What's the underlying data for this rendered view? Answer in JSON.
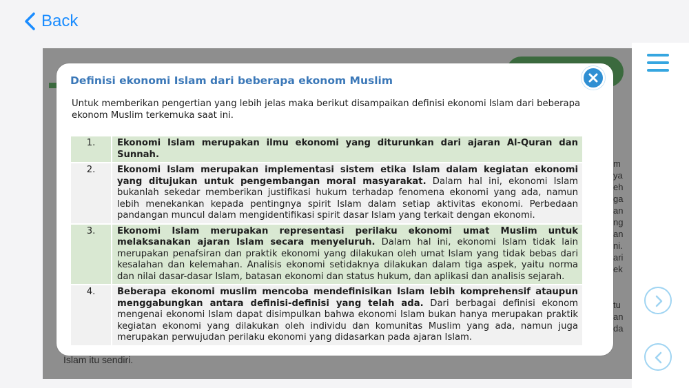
{
  "nav": {
    "back_label": "Back"
  },
  "background": {
    "fragments_top": [
      "m",
      "ya",
      "eh",
      "ga",
      "an",
      "ng",
      "an",
      "ni.",
      "ari",
      "ek"
    ],
    "fragments_bottom": [
      "tu",
      "an",
      "da"
    ],
    "bottom_text": "Islam itu sendiri."
  },
  "modal": {
    "title": "Definisi ekonomi Islam dari beberapa ekonom Muslim",
    "intro": "Untuk memberikan pengertian yang lebih jelas maka berikut disampaikan definisi ekonomi Islam dari beberapa ekonom Muslim terkemuka saat ini.",
    "items": [
      {
        "num": "1.",
        "bold": "Ekonomi Islam merupakan ilmu ekonomi yang diturunkan dari ajaran Al-Quran dan Sunnah.",
        "rest": ""
      },
      {
        "num": "2.",
        "bold": "Ekonomi Islam merupakan implementasi sistem etika Islam dalam kegiatan ekonomi yang ditujukan untuk pengembangan moral masyarakat.",
        "rest": " Dalam hal ini, ekonomi Islam bukanlah sekedar memberikan justifikasi hukum terhadap fenomena ekonomi yang ada, namun lebih menekankan kepada pentingnya spirit Islam dalam setiap aktivitas ekonomi. Perbedaan pandangan muncul dalam mengidentifikasi spirit dasar Islam yang terkait dengan ekonomi."
      },
      {
        "num": "3.",
        "bold": "Ekonomi Islam merupakan representasi perilaku ekonomi umat Muslim untuk melaksanakan ajaran Islam secara menyeluruh.",
        "rest": " Dalam hal ini, ekonomi Islam tidak lain merupakan penafsiran dan praktik ekonomi yang dilakukan oleh umat Islam yang tidak bebas dari kesalahan dan kelemahan. Analisis ekonomi setidaknya dilakukan dalam tiga aspek, yaitu norma dan nilai dasar-dasar Islam, batasan ekonomi dan status hukum, dan aplikasi dan analisis sejarah."
      },
      {
        "num": "4.",
        "bold": "Beberapa ekonomi muslim mencoba mendefinisikan Islam lebih komprehensif ataupun menggabungkan antara definisi-definisi yang telah ada.",
        "rest": " Dari berbagai definisi ekonom mengenai ekonomi Islam dapat disimpulkan bahwa ekonomi Islam bukan hanya merupakan praktik kegiatan ekonomi yang dilakukan oleh individu dan komunitas Muslim yang ada, namun juga merupakan perwujudan perilaku ekonomi yang didasarkan pada ajaran Islam."
      }
    ]
  },
  "icons": {
    "back": "chevron-left-icon",
    "menu": "hamburger-menu-icon",
    "next": "chevron-right-circle-icon",
    "prev": "chevron-left-circle-icon",
    "close": "close-x-icon"
  },
  "colors": {
    "accent": "#1a8cff",
    "title": "#3b78b8",
    "close_button": "#2f8fd3",
    "row_green": "#d9e8d2",
    "row_gray": "#f1f1f1"
  }
}
